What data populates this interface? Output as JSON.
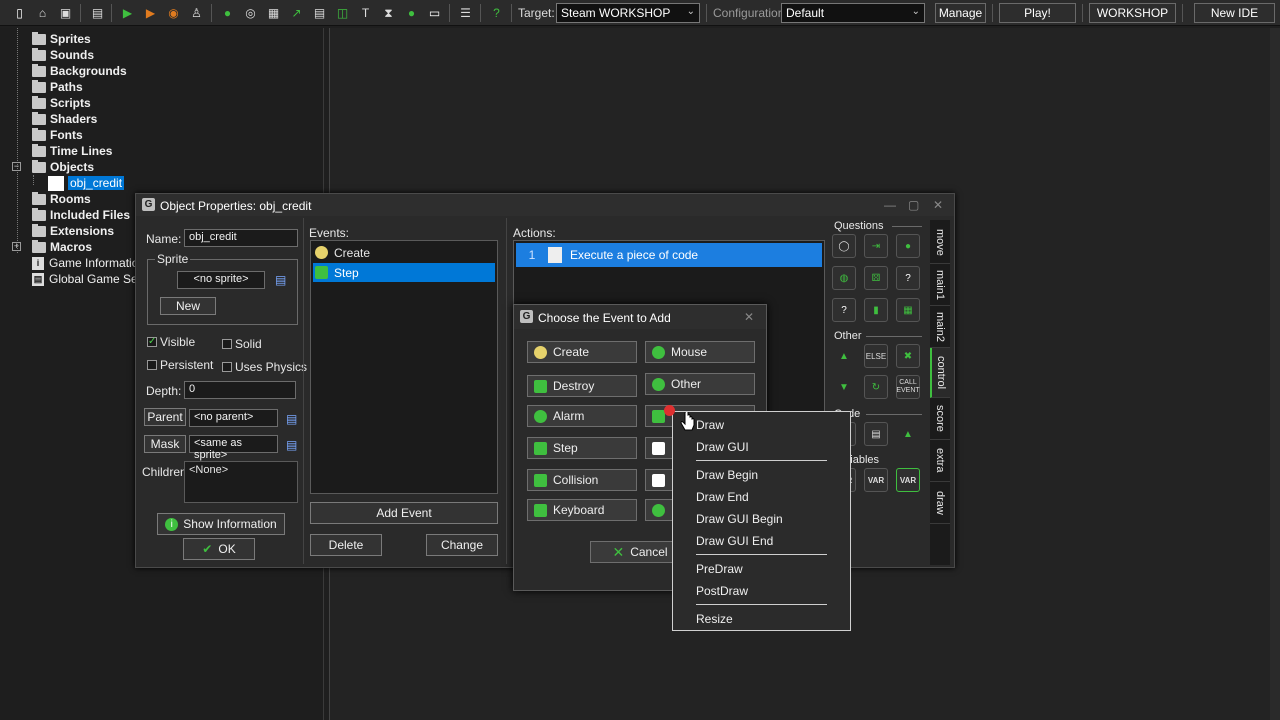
{
  "toolbar": {
    "target_label": "Target:",
    "target_value": "Steam WORKSHOP",
    "config_label": "Configuration:",
    "config_value": "Default",
    "manage_label": "Manage",
    "play_label": "Play!",
    "workshop_label": "WORKSHOP",
    "newide_label": "New IDE"
  },
  "tree": {
    "items": [
      "Sprites",
      "Sounds",
      "Backgrounds",
      "Paths",
      "Scripts",
      "Shaders",
      "Fonts",
      "Time Lines",
      "Objects",
      "obj_credit",
      "Rooms",
      "Included Files",
      "Extensions",
      "Macros",
      "Game Information",
      "Global Game Sett"
    ]
  },
  "objwin": {
    "title": "Object Properties: obj_credit",
    "name_label": "Name:",
    "name_value": "obj_credit",
    "sprite_group": "Sprite",
    "sprite_value": "<no sprite>",
    "new_label": "New",
    "visible_label": "Visible",
    "solid_label": "Solid",
    "persistent_label": "Persistent",
    "physics_label": "Uses Physics",
    "depth_label": "Depth:",
    "depth_value": "0",
    "parent_label": "Parent",
    "parent_value": "<no parent>",
    "mask_label": "Mask",
    "mask_value": "<same as sprite>",
    "children_label": "Children:",
    "children_value": "<None>",
    "show_info_label": "Show Information",
    "ok_label": "OK",
    "events_label": "Events:",
    "events": [
      "Create",
      "Step"
    ],
    "add_event_label": "Add Event",
    "delete_label": "Delete",
    "change_label": "Change",
    "actions_label": "Actions:",
    "action_num": "1",
    "action_text": "Execute a piece of code"
  },
  "palette": {
    "questions": "Questions",
    "other": "Other",
    "code": "Code",
    "variables": "Variables",
    "else_label": "ELSE",
    "call_event_label": "CALL EVENT",
    "var_label": "VAR",
    "tabs": [
      "move",
      "main1",
      "main2",
      "control",
      "score",
      "extra",
      "draw"
    ]
  },
  "evdlg": {
    "title": "Choose the Event to Add",
    "buttons_left": [
      "Create",
      "Destroy",
      "Alarm",
      "Step",
      "Collision",
      "Keyboard"
    ],
    "buttons_right": [
      "Mouse",
      "Other"
    ],
    "cancel_label": "Cancel"
  },
  "drawmenu": {
    "items": [
      "Draw",
      "Draw GUI",
      "Draw Begin",
      "Draw End",
      "Draw GUI Begin",
      "Draw GUI End",
      "PreDraw",
      "PostDraw",
      "Resize"
    ]
  },
  "colors": {
    "selection": "#0078d7",
    "accent_green": "#3fbf3f"
  }
}
